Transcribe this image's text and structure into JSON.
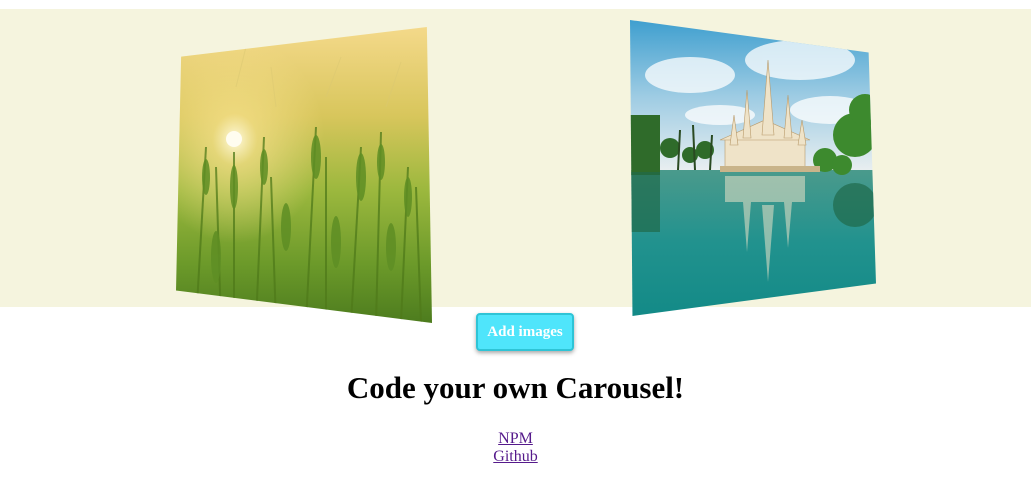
{
  "carousel": {
    "background_color": "#f5f4de",
    "slides": [
      {
        "name": "wheat-field-sunset-image"
      },
      {
        "name": "temple-reflection-image"
      }
    ]
  },
  "button": {
    "label": "Add images",
    "color": "#4fe5fb"
  },
  "heading": {
    "text": "Code your own Carousel!"
  },
  "links": [
    {
      "label": "NPM"
    },
    {
      "label": "Github"
    }
  ]
}
